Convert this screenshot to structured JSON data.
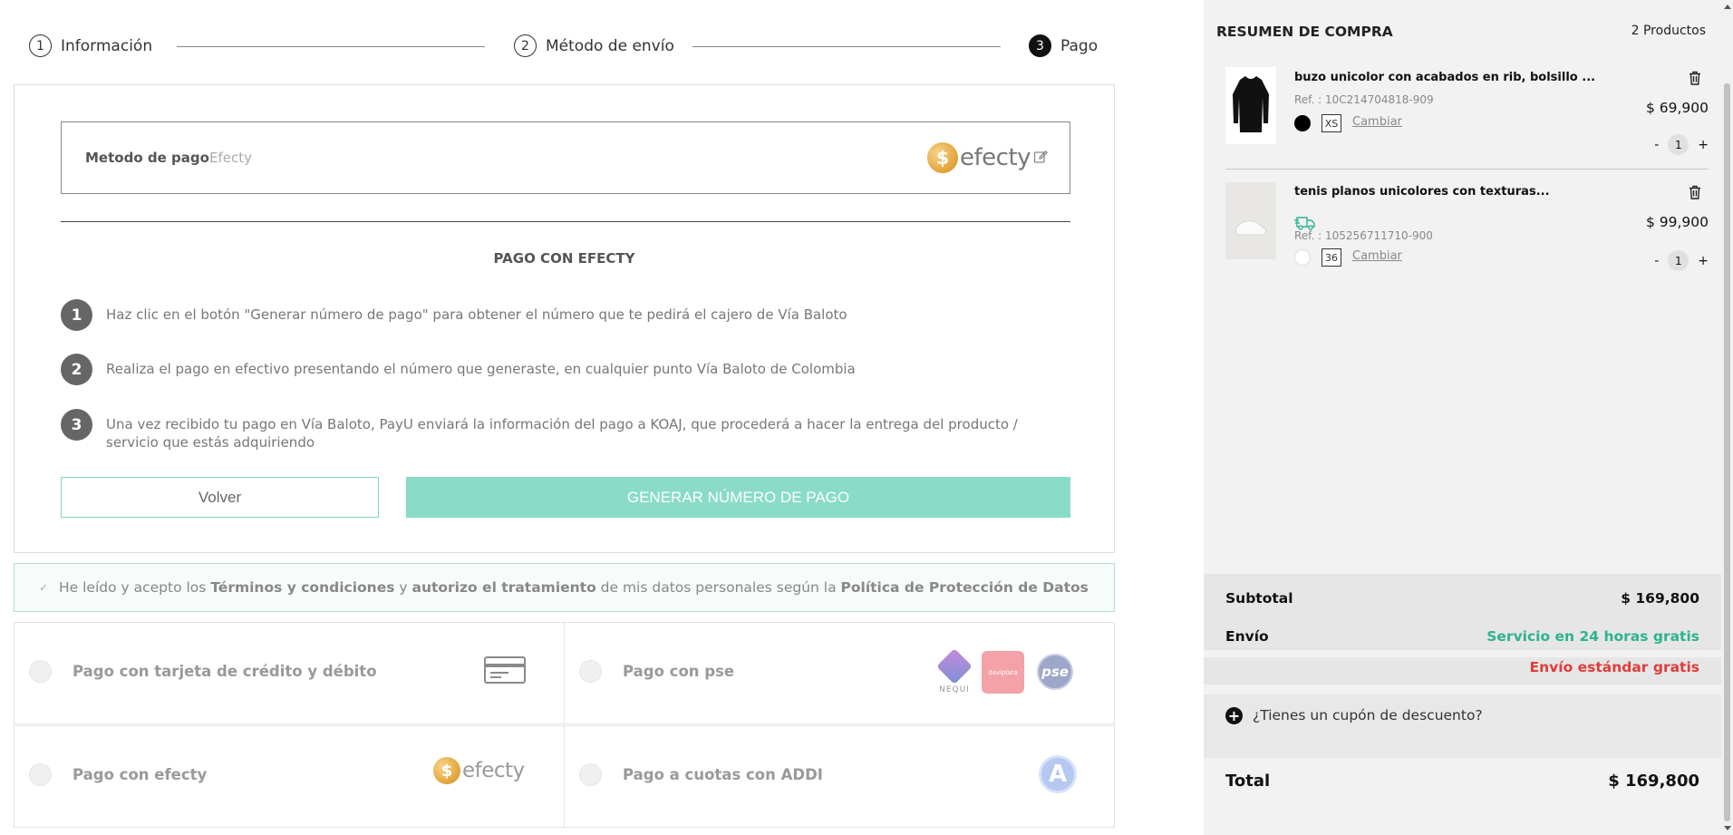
{
  "stepper": {
    "steps": [
      {
        "num": "1",
        "label": "Información"
      },
      {
        "num": "2",
        "label": "Método de envío"
      },
      {
        "num": "3",
        "label": "Pago"
      }
    ],
    "active": 3
  },
  "payment_method": {
    "label": "Metodo de pago",
    "value": "Efecty",
    "logo_text": "efecty",
    "logo_coin": "$"
  },
  "efecty_section": {
    "title": "PAGO CON EFECTY",
    "instructions": [
      {
        "num": "1",
        "text": "Haz clic en el botón \"Generar número de pago\" para obtener el número que te pedirá el cajero de Vía Baloto"
      },
      {
        "num": "2",
        "text": "Realiza el pago en efectivo presentando el número que generaste, en cualquier punto Vía Baloto de Colombia"
      },
      {
        "num": "3",
        "text": "Una vez recibido tu pago en Vía Baloto, PayU enviará la información del pago a KOAJ, que procederá a hacer la entrega del producto / servicio que estás adquiriendo"
      }
    ],
    "back_label": "Volver",
    "generate_label": "GENERAR NÚMERO DE PAGO"
  },
  "terms": {
    "t1": "He leído y acepto los ",
    "b1": "Términos y condiciones",
    "t2": " y ",
    "b2": "autorizo el tratamiento",
    "t3": " de mis datos personales según la ",
    "b3": "Política de Protección de Datos"
  },
  "payment_options": {
    "card": "Pago con tarjeta de crédito y débito",
    "pse": "Pago con pse",
    "efecty": "Pago con efecty",
    "addi": "Pago a cuotas con ADDI",
    "nequi_text": "NEQUI",
    "daviplata_text": "daviplata",
    "pse_text": "pse",
    "addi_text": "A"
  },
  "summary": {
    "title": "RESUMEN DE COMPRA",
    "count": "2 Productos",
    "items": [
      {
        "name": "buzo unicolor con acabados en rib, bolsillo ...",
        "ref": "Ref. : 10C214704818-909",
        "price": "$ 69,900",
        "size": "XS",
        "change": "Cambiar",
        "minus": "-",
        "qty": "1",
        "plus": "+",
        "swatch_color": "#000000"
      },
      {
        "name": "tenis planos unicolores con texturas...",
        "ref": "Ref. : 105256711710-900",
        "price": "$ 99,900",
        "size": "36",
        "change": "Cambiar",
        "minus": "-",
        "qty": "1",
        "plus": "+",
        "swatch_color": "#ffffff"
      }
    ],
    "subtotal_label": "Subtotal",
    "subtotal_value": "$ 169,800",
    "shipping_label": "Envío",
    "shipping_value": "Servicio en 24 horas gratis",
    "shipping_standard": "Envío estándar gratis",
    "coupon_label": "¿Tienes un cupón de descuento?",
    "total_label": "Total",
    "total_value": "$ 169,800"
  },
  "colors": {
    "accent": "#89dcc7",
    "green_text": "#2db38e",
    "red_text": "#e03c3c"
  }
}
